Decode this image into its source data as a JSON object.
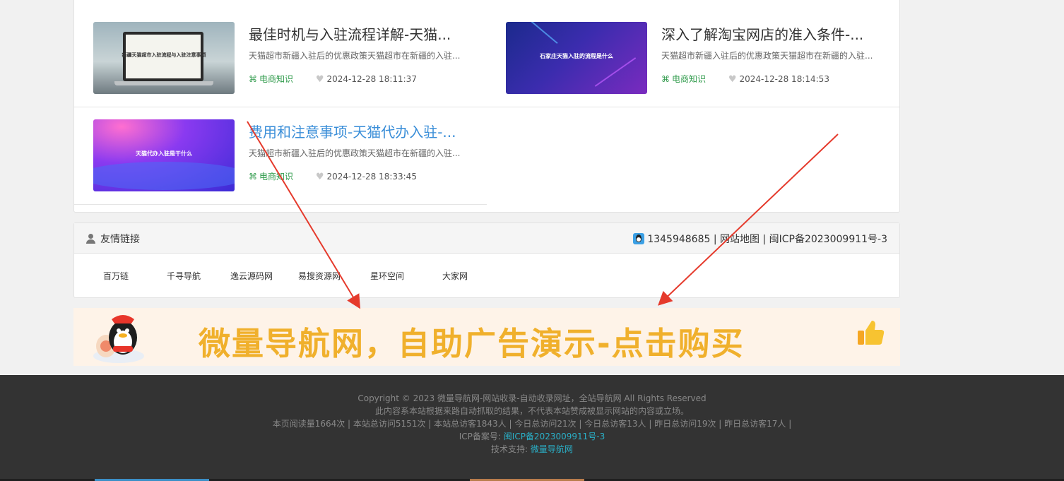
{
  "articles": [
    {
      "title": "最佳时机与入驻流程详解-天猫...",
      "desc": "天猫超市新疆入驻后的优惠政策天猫超市在新疆的入驻...",
      "category": "电商知识",
      "date": "2024-12-28 18:11:37",
      "thumb_text": "新疆天猫超市入驻流程与入驻注意事项"
    },
    {
      "title": "深入了解淘宝网店的准入条件-...",
      "desc": "天猫超市新疆入驻后的优惠政策天猫超市在新疆的入驻...",
      "category": "电商知识",
      "date": "2024-12-28 18:14:53",
      "thumb_text": "石家庄天猫入驻的流程是什么"
    },
    {
      "title": "费用和注意事项-天猫代办入驻-...",
      "desc": "天猫超市新疆入驻后的优惠政策天猫超市在新疆的入驻...",
      "category": "电商知识",
      "date": "2024-12-28 18:33:45",
      "thumb_text": "天猫代办入驻是干什么"
    }
  ],
  "links": {
    "title": "友情链接",
    "contact": "1345948685 | 网站地图 | 闽ICP备2023009911号-3",
    "items": [
      "百万链",
      "千寻导航",
      "逸云源码网",
      "易搜资源网",
      "星环空间",
      "大家网"
    ]
  },
  "ad": {
    "text": "微量导航网，自助广告演示-点击购买"
  },
  "footer": {
    "copyright": "Copyright © 2023 微量导航网-网站收录-自动收录网址，全站导航网 All Rights Reserved",
    "disclaimer": "此内容系本站根据来路自动抓取的结果，不代表本站赞成被显示网站的内容或立场。",
    "stats": "本页阅读量1664次 | 本站总访问5151次 | 本站总访客1843人 | 今日总访问21次 | 今日总访客13人 | 昨日总访问19次 | 昨日总访客17人 |",
    "icp_label": "ICP备案号:",
    "icp_link": "闽ICP备2023009911号-3",
    "support_label": "技术支持:",
    "support_link": "微量导航网"
  },
  "colors": {
    "category_green": "#2e9a4a",
    "link_hover_blue": "#3a8ed8",
    "ad_orange": "#f0b02c",
    "footer_link": "#2ab0c8",
    "arrow_red": "#e53a2c"
  }
}
